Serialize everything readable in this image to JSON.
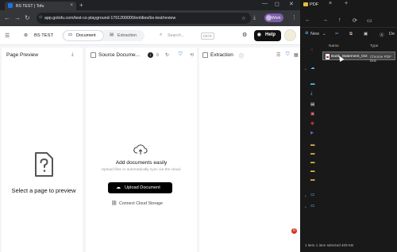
{
  "browser": {
    "tab_title": "BS TEST | Tofu",
    "url": "app.gotofu.com/test-cs-playground-1761200000/entities/bs-test/review",
    "profile_label": "Work",
    "window_controls": [
      "—",
      "◻",
      "✕"
    ]
  },
  "app": {
    "project_name": "BS TEST",
    "views": [
      "Document",
      "Extraction"
    ],
    "active_view": "Document",
    "search_placeholder": "Search...",
    "search_shortcut": "Ctrl K",
    "help_label": "Help",
    "notification_count": "0"
  },
  "panels": {
    "page_preview": {
      "title": "Page Preview",
      "empty_text": "Select a page to preview"
    },
    "source_documents": {
      "title": "Source Docume...",
      "count": "0",
      "empty_title": "Add documents easily",
      "empty_subtitle": "Upload files or automatically sync via the cloud.",
      "upload_label": "Upload Document",
      "connect_label": "Connect Cloud Storage"
    },
    "extraction": {
      "title": "Extraction"
    }
  },
  "explorer": {
    "tab_title": "PDF",
    "new_label": "New",
    "columns": [
      "Name",
      "Type"
    ],
    "files": [
      {
        "name": "Bank_Statement_Oct",
        "type": "Chrome PDF Doc"
      }
    ],
    "toolbar_right": "De",
    "status": "1 item    1 item selected  409 KB"
  },
  "colors": {
    "accent_blue": "#2f80ed",
    "folder_yellow": "#e8b84a",
    "profile_purple": "#7b5ea7"
  }
}
